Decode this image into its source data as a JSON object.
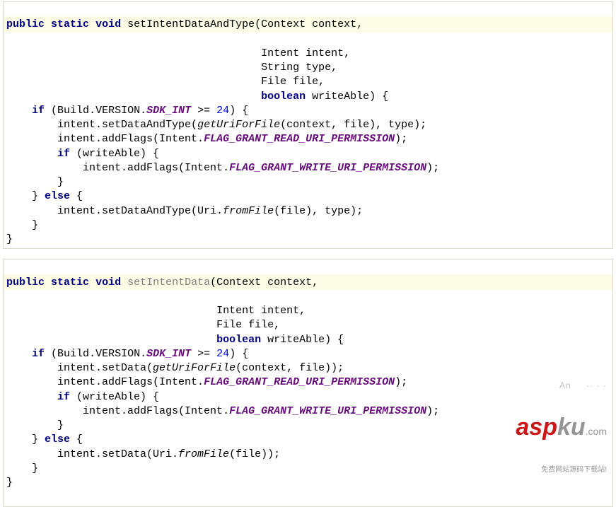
{
  "block1": {
    "sig": {
      "kw_public": "public",
      "kw_static": "static",
      "kw_void": "void",
      "name": "setIntentDataAndType",
      "p1_type": "Context",
      "p1_name": "context",
      "p2_type": "Intent",
      "p2_name": "intent",
      "p3_type": "String",
      "p3_name": "type",
      "p4_type": "File",
      "p4_name": "file",
      "p5_kw": "boolean",
      "p5_name": "writeAble"
    },
    "body": {
      "if_kw": "if",
      "build": "Build",
      "version": "VERSION",
      "sdk": "SDK_INT",
      "ge": ">=",
      "num24": "24",
      "l1_a": "intent.setDataAndType(",
      "l1_call": "getUriForFile",
      "l1_b": "(context, file), type);",
      "l2_a": "intent.addFlags(Intent.",
      "l2_flag": "FLAG_GRANT_READ_URI_PERMISSION",
      "l2_b": ");",
      "if2_kw": "if",
      "if2_cond": " (writeAble) {",
      "l3_a": "intent.addFlags(Intent.",
      "l3_flag": "FLAG_GRANT_WRITE_URI_PERMISSION",
      "l3_b": ");",
      "close1": "}",
      "else_a": "} ",
      "else_kw": "else",
      "else_b": " {",
      "l4_a": "intent.setDataAndType(Uri.",
      "l4_call": "fromFile",
      "l4_b": "(file), type);",
      "close2": "}",
      "close3": "}"
    }
  },
  "block2": {
    "sig": {
      "kw_public": "public",
      "kw_static": "static",
      "kw_void": "void",
      "name": "setIntentData",
      "p1_type": "Context",
      "p1_name": "context",
      "p2_type": "Intent",
      "p2_name": "intent",
      "p3_type": "File",
      "p3_name": "file",
      "p4_kw": "boolean",
      "p4_name": "writeAble"
    },
    "body": {
      "if_kw": "if",
      "build": "Build",
      "version": "VERSION",
      "sdk": "SDK_INT",
      "ge": ">=",
      "num24": "24",
      "l1_a": "intent.setData(",
      "l1_call": "getUriForFile",
      "l1_b": "(context, file));",
      "l2_a": "intent.addFlags(Intent.",
      "l2_flag": "FLAG_GRANT_READ_URI_PERMISSION",
      "l2_b": ");",
      "if2_kw": "if",
      "if2_cond": " (writeAble) {",
      "l3_a": "intent.addFlags(Intent.",
      "l3_flag": "FLAG_GRANT_WRITE_URI_PERMISSION",
      "l3_b": ");",
      "close1": "}",
      "else_a": "} ",
      "else_kw": "else",
      "else_b": " {",
      "l4_a": "intent.setData(Uri.",
      "l4_call": "fromFile",
      "l4_b": "(file));",
      "close2": "}",
      "close3": "}"
    }
  },
  "watermark": {
    "top": "An     ·· · ·",
    "mid_red": "asp",
    "mid_grey": "ku",
    "mid_tail": ".com",
    "bot": "免费网站源码下载站!"
  }
}
